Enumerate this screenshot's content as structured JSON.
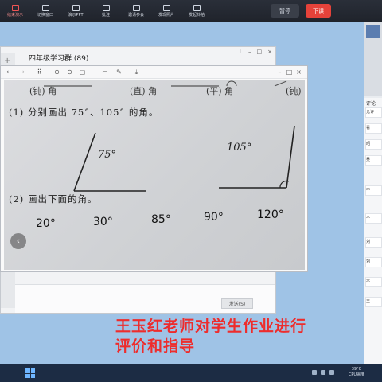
{
  "toolbar": {
    "items": [
      "结束演示",
      "切换窗口",
      "演示PPT",
      "批注",
      "邀请参会",
      "发现照片",
      "发起抖拍"
    ],
    "pause_label": "暂停",
    "end_label": "下课"
  },
  "chat": {
    "title": "四年级学习群 (89)",
    "send_label": "发送(S)"
  },
  "viewer": {
    "prev_icon": "chevron-left-icon"
  },
  "worksheet": {
    "top_labels": [
      "(钝) 角",
      "(直) 角",
      "(平) 角",
      "(钝)"
    ],
    "q1_text": "(1) 分别画出 75°、105° 的角。",
    "angle_75": "75°",
    "angle_105": "105°",
    "q2_text": "(2) 画出下面的角。",
    "angles": [
      "20°",
      "30°",
      "85°",
      "90°",
      "120°"
    ]
  },
  "side_panel": {
    "comment_title": "评论",
    "rows": [
      "允许",
      "看",
      "晒",
      "吴",
      "不",
      "不",
      "刘",
      "刘",
      "不",
      "王"
    ]
  },
  "caption": {
    "line1": "王玉红老师对学生作业进行",
    "line2": "评价和指导"
  },
  "taskbar": {
    "temp": "39°C",
    "cpu": "CPU温度"
  },
  "colors": {
    "accent_red": "#e5423a",
    "caption_red": "#ee2c2c",
    "toolbar_bg": "#1f232b"
  }
}
